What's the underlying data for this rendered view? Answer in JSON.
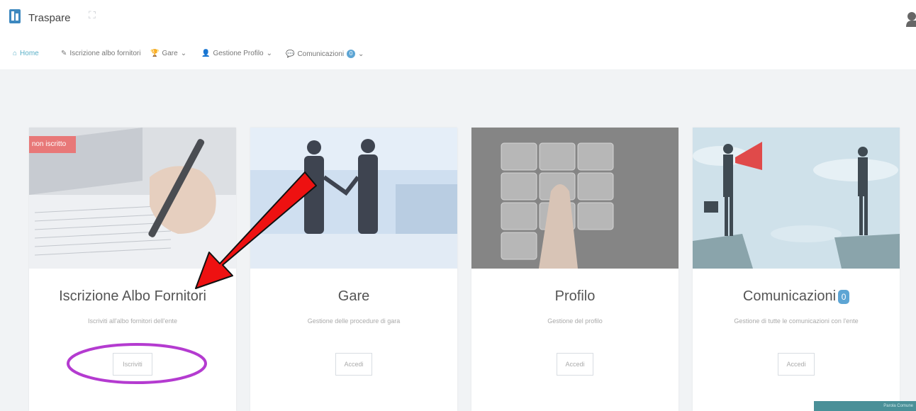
{
  "app": {
    "title": "Traspare",
    "expand_icon": "expand-icon",
    "user_icon": "user-icon"
  },
  "nav": {
    "home": "Home",
    "iscrizione": "Iscrizione albo fornitori",
    "gare": "Gare",
    "gestione_profilo": "Gestione Profilo",
    "comunicazioni": "Comunicazioni",
    "comunicazioni_count": "0"
  },
  "cards": [
    {
      "title": "Iscrizione Albo Fornitori",
      "description": "Iscriviti all'albo fornitori dell'ente",
      "button": "Iscriviti",
      "status": "non iscritto"
    },
    {
      "title": "Gare",
      "description": "Gestione delle procedure di gara",
      "button": "Accedi"
    },
    {
      "title": "Profilo",
      "description": "Gestione del profilo",
      "button": "Accedi"
    },
    {
      "title": "Comunicazioni",
      "count": "0",
      "description": "Gestione di tutte le comunicazioni con l'ente",
      "button": "Accedi"
    }
  ],
  "footer": {
    "text": "Parola Comune"
  },
  "colors": {
    "accent": "#5da5d4",
    "status_badge": "#e87878",
    "annotation_arrow": "#ee1111",
    "annotation_ellipse": "#b43bd0",
    "footer_bar": "#4a9098"
  }
}
